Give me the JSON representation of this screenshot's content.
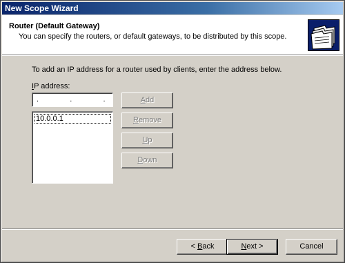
{
  "window": {
    "title": "New Scope Wizard"
  },
  "header": {
    "title": "Router (Default Gateway)",
    "subtitle": "You can specify the routers, or default gateways, to be distributed by this scope."
  },
  "body": {
    "instruction": "To add an IP address for a router used by clients, enter the address below.",
    "ip_label_accel": "I",
    "ip_label_rest": "P address:",
    "ip_input_value": ".   .   .",
    "routers": [
      "10.0.0.1"
    ]
  },
  "side_buttons": {
    "add": {
      "accel": "A",
      "rest": "dd"
    },
    "remove": {
      "accel": "R",
      "rest": "emove"
    },
    "up": {
      "accel": "U",
      "rest": "p"
    },
    "down": {
      "accel": "D",
      "rest": "own"
    }
  },
  "footer": {
    "back": {
      "prefix": "< ",
      "accel": "B",
      "rest": "ack"
    },
    "next": {
      "accel": "N",
      "rest": "ext >"
    },
    "cancel": "Cancel"
  },
  "colors": {
    "titlebar_start": "#0a246a",
    "titlebar_end": "#a6caf0",
    "dialog_bg": "#d4d0c8"
  },
  "icons": {
    "header": "folders-icon"
  }
}
